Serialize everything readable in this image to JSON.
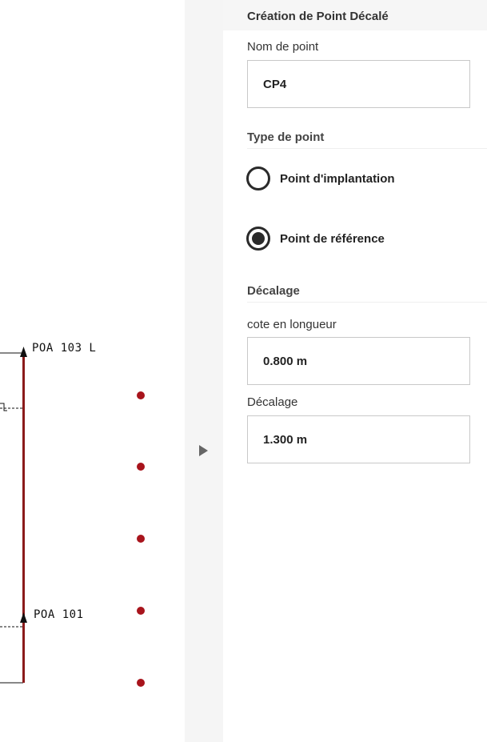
{
  "canvas": {
    "points": [
      {
        "label": "POA 103 L"
      },
      {
        "label": "POA 101"
      }
    ],
    "colors": {
      "line": "#8b1a1a",
      "dot": "#a8141c",
      "ink": "#111111"
    }
  },
  "panel": {
    "title": "Création de Point Décalé",
    "name_label": "Nom de point",
    "name_value": "CP4",
    "type_section": "Type de point",
    "type_options": [
      {
        "label": "Point d'implantation",
        "selected": false
      },
      {
        "label": "Point de référence",
        "selected": true
      }
    ],
    "offset_section": "Décalage",
    "length_label": "cote en longueur",
    "length_value": "0.800 m",
    "offset_label": "Décalage",
    "offset_value": "1.300 m"
  }
}
